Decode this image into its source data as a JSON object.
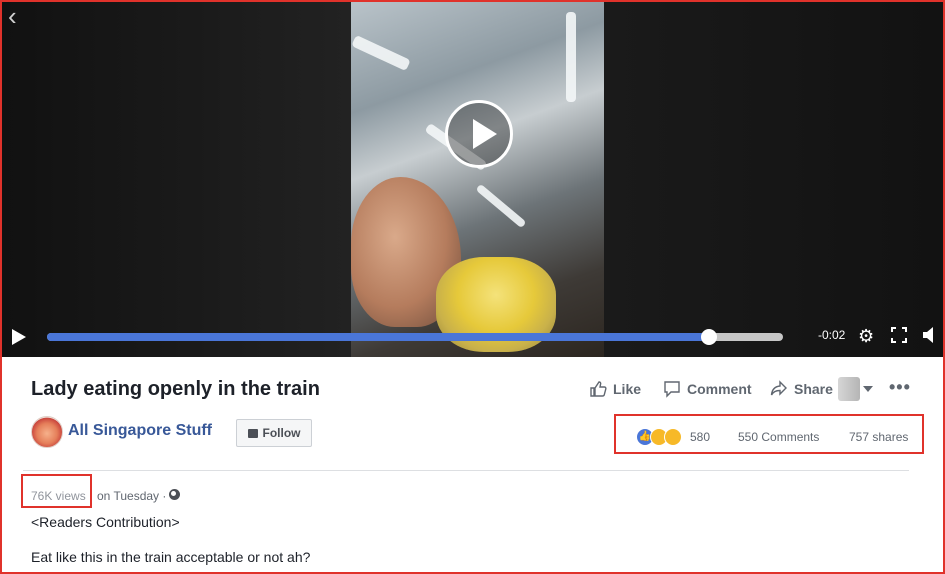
{
  "video": {
    "back_icon": "back-arrow-icon",
    "play_icon": "play-icon",
    "time_remaining": "-0:02",
    "progress_fraction": 0.9,
    "icons": [
      "settings-icon",
      "fullscreen-icon",
      "volume-icon"
    ]
  },
  "post": {
    "title": "Lady eating openly in the train",
    "like_label": "Like",
    "comment_label": "Comment",
    "share_label": "Share",
    "page_name": "All Singapore Stuff",
    "follow_label": "Follow",
    "reaction_count": "580",
    "comments_count": "550 Comments",
    "shares_count": "757 shares",
    "views": "76K views",
    "posted_time": "on Tuesday ·",
    "description_line1": "<Readers Contribution>",
    "description_line2": "Eat like this in the train acceptable or not ah?"
  },
  "colors": {
    "highlight": "#e0322b",
    "progress": "#4a76d8",
    "link": "#385898"
  }
}
